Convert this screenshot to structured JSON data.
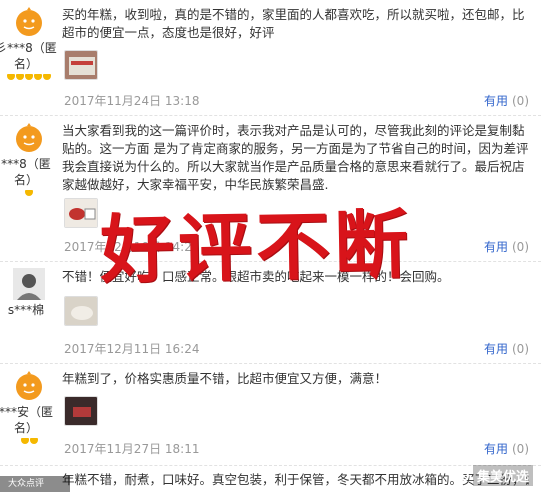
{
  "colors": {
    "accent_link": "#3366cc",
    "overlay_red": "#d8141a",
    "meta_gray": "#999999",
    "gem": "#f5b800"
  },
  "reviews": [
    {
      "user": "彡***8（匿名）",
      "user_line1": "彡***8（匿",
      "user_line2": "名）",
      "level_gems": 5,
      "text": "买的年糕，收到啦，真的是不错的，家里面的人都喜欢吃，所以就买啦，还包邮，比超市的便宜一点，态度也是很好，好评",
      "date": "2017年11月24日 13:18",
      "useful_label": "有用",
      "useful_count": "(0)"
    },
    {
      "user": "***8（匿名）",
      "user_line1": "***8（匿",
      "user_line2": "名）",
      "level_gems": 1,
      "text": "当大家看到我的这一篇评价时，表示我对产品是认可的，尽管我此刻的评论是复制黏贴的。这一方面 是为了肯定商家的服务，另一方面是为了节省自己的时间，因为差评我会直接说为什么的。所以大家就当作是产品质量合格的意思来看就行了。最后祝店家越做越好，大家幸福平安，中华民族繁荣昌盛.",
      "date": "2017年12月10日 14:28",
      "useful_label": "有用",
      "useful_count": "(0)"
    },
    {
      "user": "s***棉",
      "user_line1": "s***棉",
      "user_line2": "",
      "level_gems": 0,
      "text": "不错！便宜好吃，口感正常。跟超市卖的吃起来一模一样的！会回购。",
      "date": "2017年12月11日 16:24",
      "useful_label": "有用",
      "useful_count": "(0)"
    },
    {
      "user": "***安（匿名）",
      "user_line1": "***安（匿",
      "user_line2": "名）",
      "level_gems": 2,
      "text": "年糕到了，价格实惠质量不错，比超市便宜又方便，满意！",
      "date": "2017年11月27日 18:11",
      "useful_label": "有用",
      "useful_count": "(0)"
    },
    {
      "user": "",
      "user_line1": "",
      "user_line2": "",
      "level_gems": 0,
      "text": "年糕不错，耐煮，口味好。真空包装，利于保管，冬天都不用放冰箱的。买了二份，谢谢",
      "date": "",
      "useful_label": "",
      "useful_count": ""
    }
  ],
  "overlay_text": "好评不断",
  "watermark": {
    "text": "集美优选",
    "corner_badge": "大众点评"
  }
}
